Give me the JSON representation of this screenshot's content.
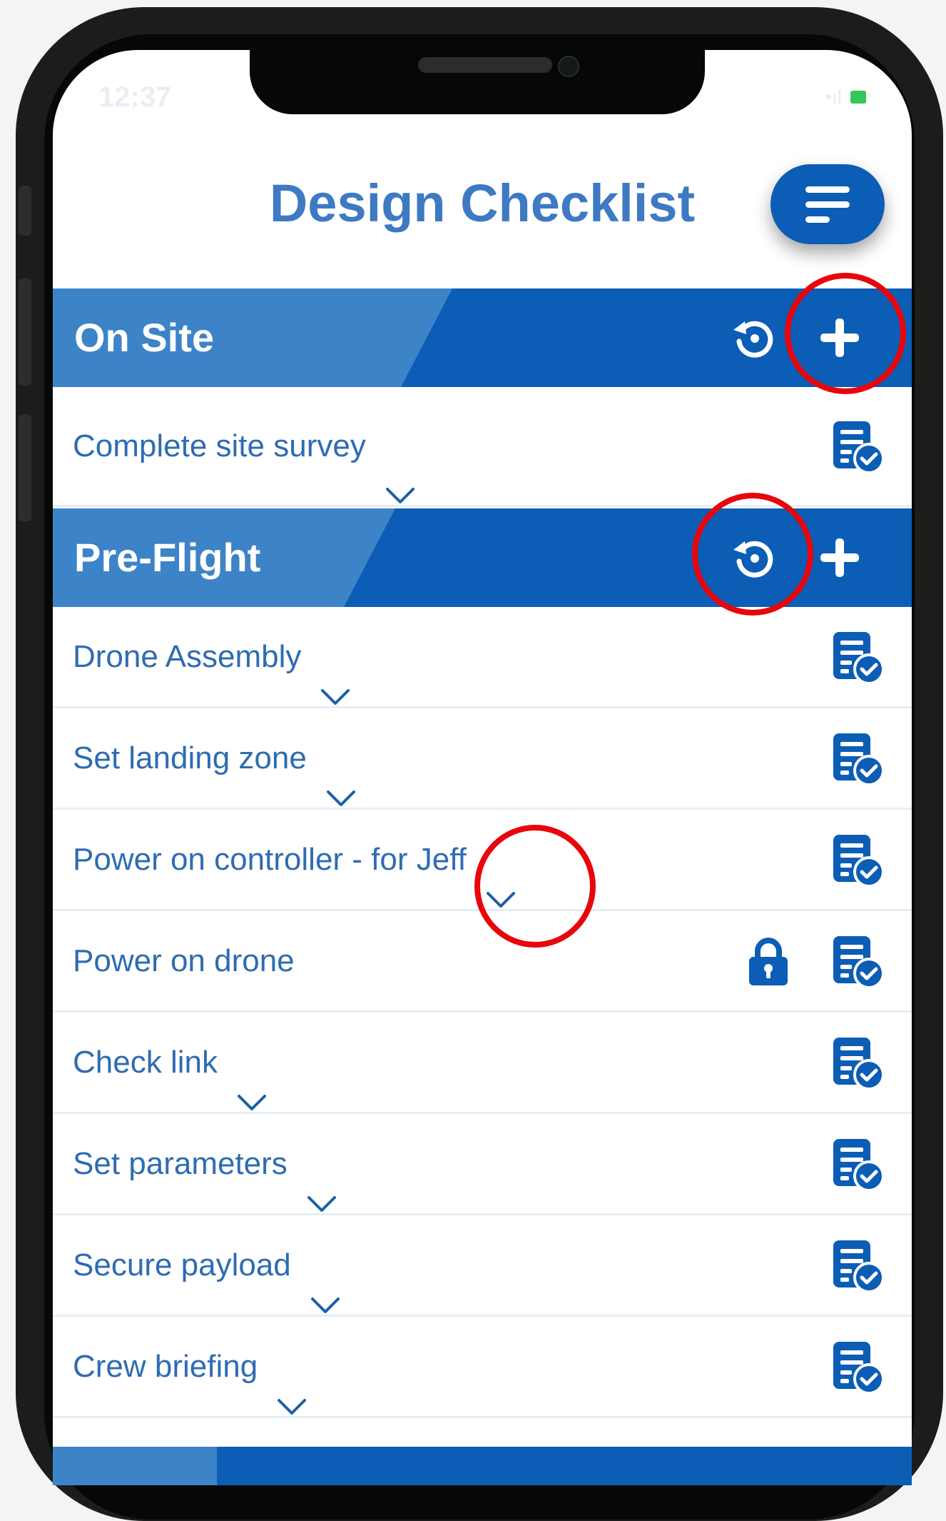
{
  "status_bar": {
    "time": "12:37",
    "signal": "•ıl"
  },
  "header": {
    "title": "Design Checklist"
  },
  "sections": [
    {
      "title": "On Site",
      "items": [
        {
          "label": "Complete site survey",
          "expandable": true,
          "locked": false
        }
      ]
    },
    {
      "title": "Pre-Flight",
      "items": [
        {
          "label": "Drone Assembly",
          "expandable": true,
          "locked": false
        },
        {
          "label": "Set landing zone",
          "expandable": true,
          "locked": false
        },
        {
          "label": "Power on controller - for Jeff",
          "expandable": true,
          "locked": false
        },
        {
          "label": "Power on drone",
          "expandable": false,
          "locked": true
        },
        {
          "label": "Check link",
          "expandable": true,
          "locked": false
        },
        {
          "label": "Set parameters",
          "expandable": true,
          "locked": false
        },
        {
          "label": "Secure payload",
          "expandable": true,
          "locked": false
        },
        {
          "label": "Crew briefing",
          "expandable": true,
          "locked": false
        }
      ]
    }
  ],
  "icons": {
    "menu": "menu-icon",
    "reset": "reset-icon",
    "add": "plus-icon",
    "expand": "chevron-down-icon",
    "checklist": "checklist-icon",
    "locked": "lock-icon"
  },
  "colors": {
    "primary": "#0c5db5",
    "primary_light": "#3d83c8",
    "text": "#2e6cb3",
    "title": "#3e7ac4",
    "highlight": "#e8050b"
  }
}
